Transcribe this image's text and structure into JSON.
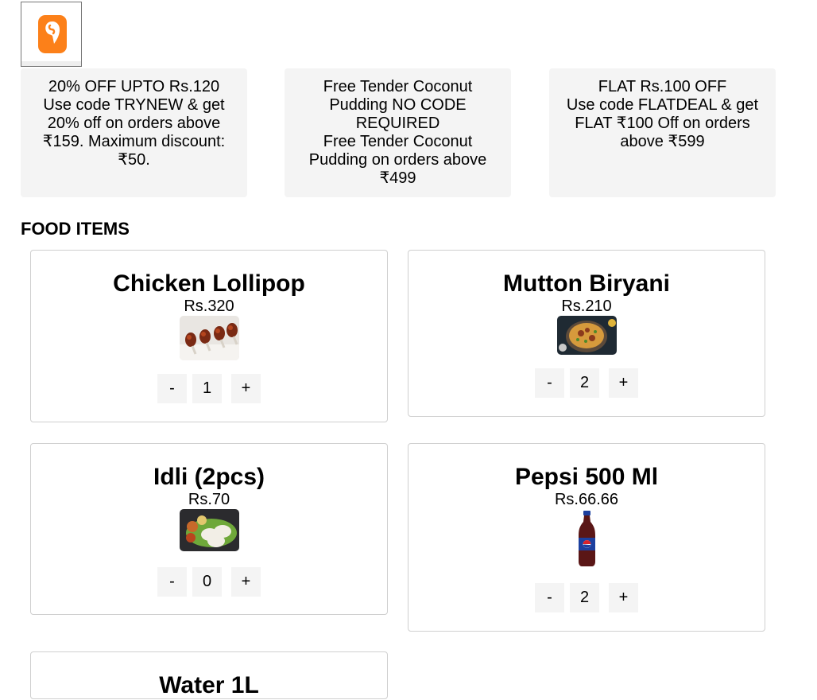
{
  "logo": {
    "name": "swiggy-logo"
  },
  "offers": [
    {
      "lines": [
        "20% OFF UPTO Rs.120",
        "Use code TRYNEW & get 20% off on orders above ₹159. Maximum discount: ₹50."
      ]
    },
    {
      "lines": [
        "Free Tender Coconut Pudding NO CODE REQUIRED",
        "Free Tender Coconut Pudding on orders above ₹499"
      ]
    },
    {
      "lines": [
        "FLAT Rs.100 OFF",
        "Use code FLATDEAL & get FLAT ₹100 Off on orders above ₹599"
      ]
    }
  ],
  "section": {
    "title": "FOOD ITEMS"
  },
  "items": [
    {
      "name": "Chicken Lollipop",
      "price": "Rs.320",
      "qty": "1",
      "minus": "-",
      "plus": "+"
    },
    {
      "name": "Mutton Biryani",
      "price": "Rs.210",
      "qty": "2",
      "minus": "-",
      "plus": "+"
    },
    {
      "name": "Idli (2pcs)",
      "price": "Rs.70",
      "qty": "0",
      "minus": "-",
      "plus": "+"
    },
    {
      "name": "Pepsi 500 Ml",
      "price": "Rs.66.66",
      "qty": "2",
      "minus": "-",
      "plus": "+"
    },
    {
      "name": "Water 1L"
    }
  ],
  "colors": {
    "brand": "#fc8019",
    "panel": "#f4f4f4",
    "border": "#cfcfcf"
  }
}
